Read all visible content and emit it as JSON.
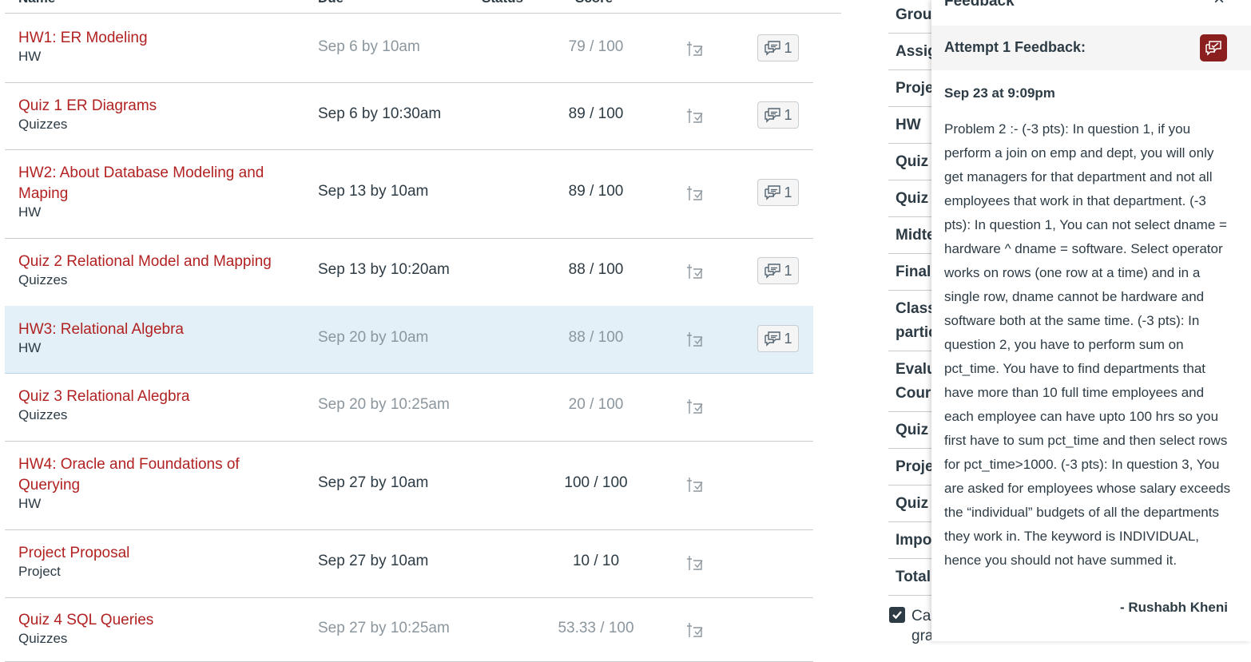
{
  "table": {
    "headers": {
      "name": "Name",
      "due": "Due",
      "status": "Status",
      "score": "Score"
    },
    "rows": [
      {
        "name": "HW1: ER Modeling",
        "category": "HW",
        "due": "Sep 6 by 10am",
        "score": "79 / 100",
        "comments": "1"
      },
      {
        "name": "Quiz 1 ER Diagrams",
        "category": "Quizzes",
        "due": "Sep 6 by 10:30am",
        "score": "89 / 100",
        "comments": "1"
      },
      {
        "name": "HW2: About Database Modeling and Maping",
        "category": "HW",
        "due": "Sep 13 by 10am",
        "score": "89 / 100",
        "comments": "1"
      },
      {
        "name": "Quiz 2 Relational Model and Mapping",
        "category": "Quizzes",
        "due": "Sep 13 by 10:20am",
        "score": "88 / 100",
        "comments": "1"
      },
      {
        "name": "HW3: Relational Algebra",
        "category": "HW",
        "due": "Sep 20 by 10am",
        "score": "88 / 100",
        "comments": "1"
      },
      {
        "name": "Quiz 3 Relational Alegbra",
        "category": "Quizzes",
        "due": "Sep 20 by 10:25am",
        "score": "20 / 100",
        "comments": ""
      },
      {
        "name": "HW4: Oracle and Foundations of Querying",
        "category": "HW",
        "due": "Sep 27 by 10am",
        "score": "100 / 100",
        "comments": ""
      },
      {
        "name": "Project Proposal",
        "category": "Project",
        "due": "Sep 27 by 10am",
        "score": "10 / 10",
        "comments": ""
      },
      {
        "name": "Quiz 4 SQL Queries",
        "category": "Quizzes",
        "due": "Sep 27 by 10:25am",
        "score": "53.33 / 100",
        "comments": ""
      }
    ]
  },
  "summary": {
    "rows": [
      "Group",
      "Assig",
      "Proje",
      "HW",
      "Quiz",
      "Quiz",
      "Midte",
      "Final",
      "Class",
      "Evalu",
      "Quiz",
      "Proje",
      "Quiz",
      "Impo",
      "Total"
    ],
    "row_second_lines": {
      "8": "partic",
      "9": "Cours"
    },
    "calc_label": "Cal",
    "calc_label_2": "gra"
  },
  "feedback": {
    "title": "Feedback",
    "close_glyph": "×",
    "attempt_label": "Attempt 1 Feedback:",
    "date": "Sep 23 at 9:09pm",
    "text": "Problem 2 :- (-3 pts): In question 1, if you perform a join on emp and dept, you will only get managers for that department and not all employees that work in that department. (-3 pts): In question 1, You can not select dname = hardware ^ dname = software. Select operator works on rows (one row at a time) and in a single row, dname cannot be hardware and software both at the same time. (-3 pts): In question 2, you have to perform sum on pct_time. You have to find departments that have more than 10 full time employees and each employee can have upto 100 hrs so you first have to sum pct_time and then select rows for pct_time>1000. (-3 pts): In question 3, You are asked for employees whose salary exceeds the “individual” budgets of all the departments they work in. The keyword is INDIVIDUAL, hence you should not have summed it.",
    "author": "- Rushabh Kheni"
  },
  "colors": {
    "link": "#b22222",
    "highlight": "#e3f0f7",
    "accent_button": "#8b1f1f",
    "text": "#2d3b45"
  }
}
